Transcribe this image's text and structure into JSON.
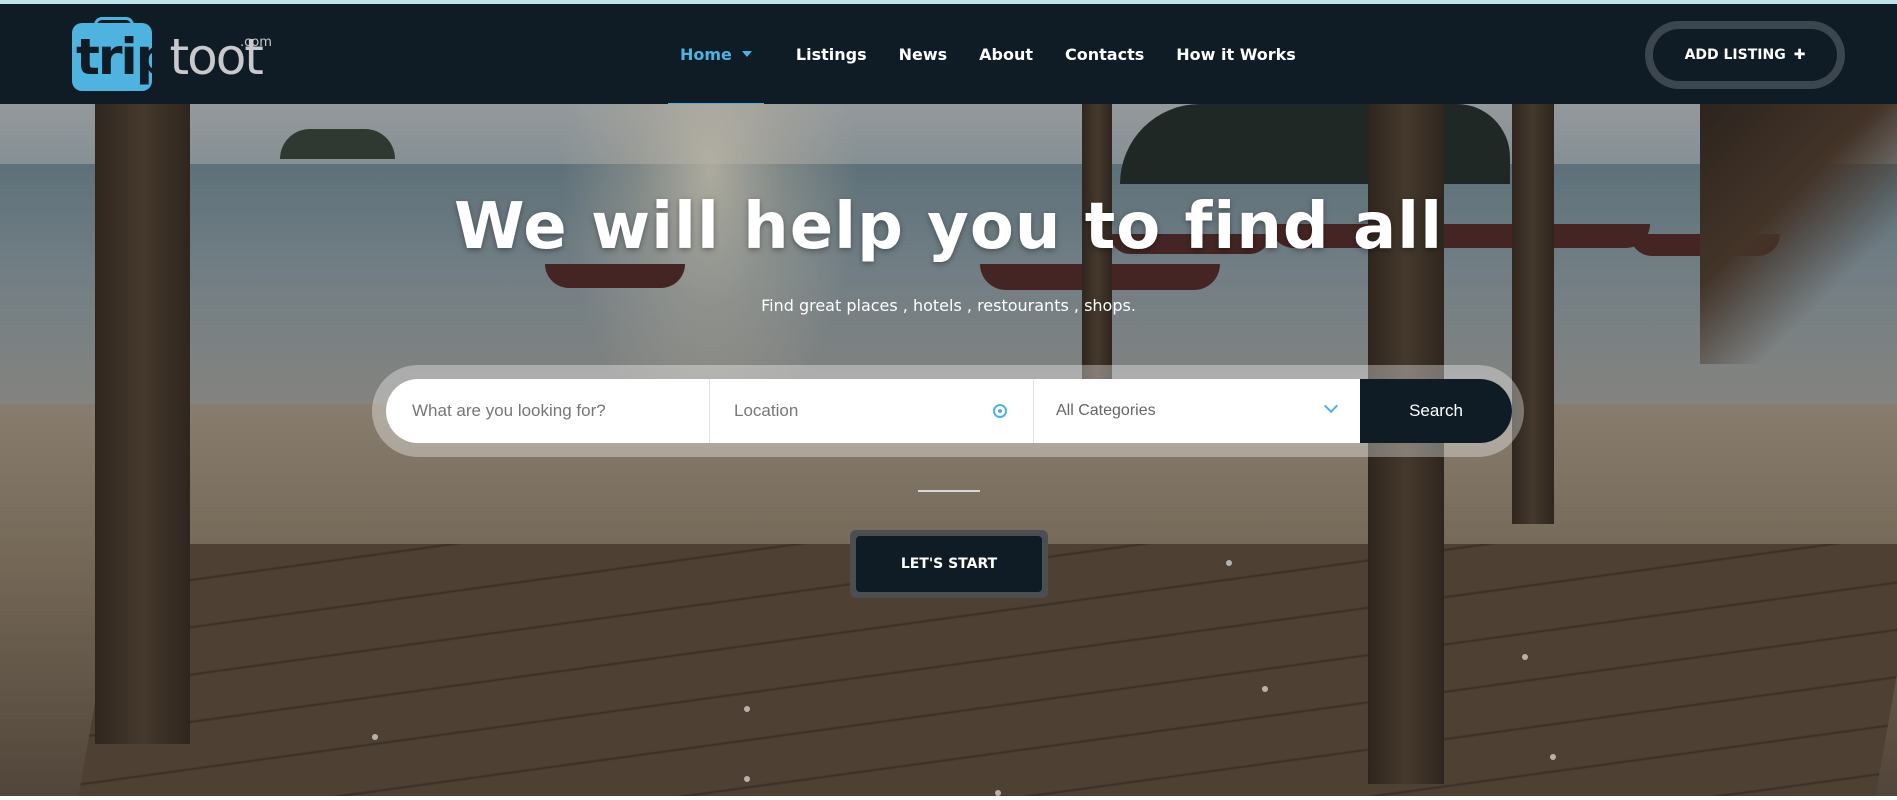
{
  "brand": {
    "logo_main": "trip",
    "logo_rest": "toot",
    "logo_suffix": ".com",
    "accent_color": "#4fb3e0",
    "header_bg": "#0f1c26"
  },
  "nav": {
    "items": [
      {
        "label": "Home",
        "active": true,
        "has_dropdown": true
      },
      {
        "label": "Listings"
      },
      {
        "label": "News"
      },
      {
        "label": "About"
      },
      {
        "label": "Contacts"
      },
      {
        "label": "How it Works"
      }
    ],
    "add_listing_label": "ADD LISTING",
    "add_listing_icon": "plus-icon"
  },
  "hero": {
    "headline": "We will help you to find all",
    "subline": "Find great places , hotels , restourants , shops."
  },
  "search": {
    "keyword_placeholder": "What are you looking for?",
    "location_placeholder": "Location",
    "location_icon": "target-location-icon",
    "category_selected": "All Categories",
    "category_icon": "chevron-down-icon",
    "button_label": "Search"
  },
  "cta": {
    "label": "LET'S START"
  }
}
